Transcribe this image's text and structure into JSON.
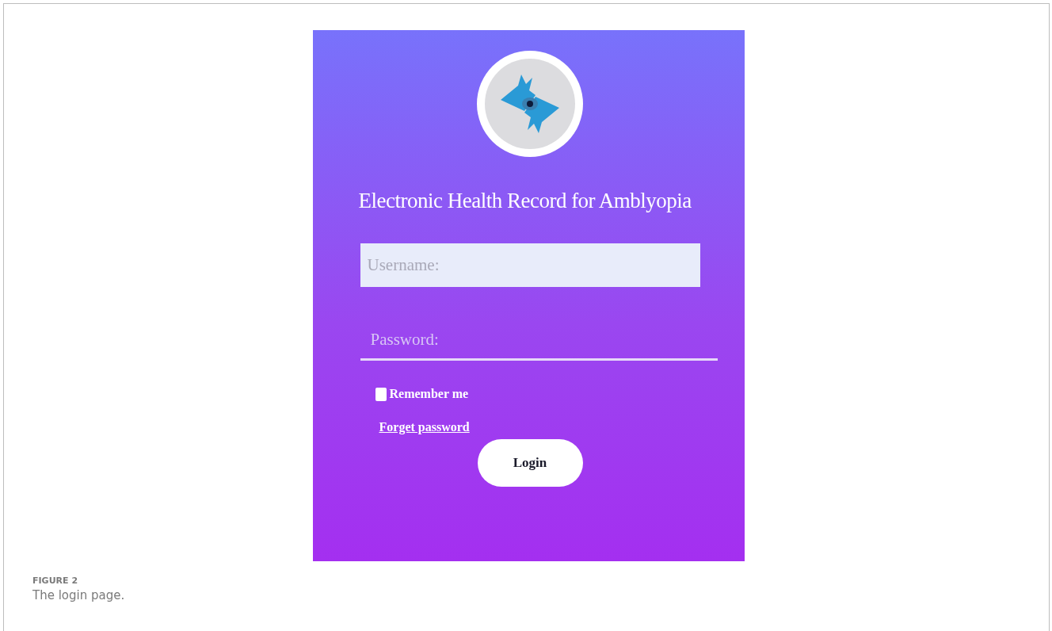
{
  "login_screen": {
    "title": "Electronic Health Record for Amblyopia",
    "username": {
      "placeholder": "Username:"
    },
    "password": {
      "placeholder": "Password:"
    },
    "remember_me": {
      "label": "Remember me",
      "checked": false
    },
    "forgot_link": "Forget password",
    "login_button": "Login"
  },
  "caption": {
    "label": "FIGURE 2",
    "text": "The login page."
  }
}
